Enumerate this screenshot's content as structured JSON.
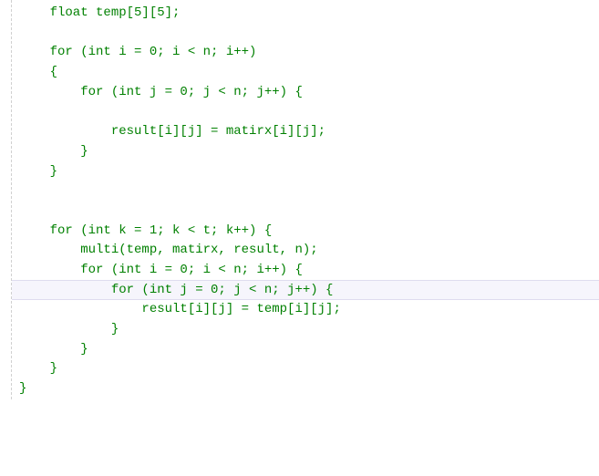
{
  "code": {
    "lines": [
      "    float temp[5][5];",
      "",
      "    for (int i = 0; i < n; i++)",
      "    {",
      "        for (int j = 0; j < n; j++) {",
      "",
      "            result[i][j] = matirx[i][j];",
      "        }",
      "    }",
      "",
      "",
      "    for (int k = 1; k < t; k++) {",
      "        multi(temp, matirx, result, n);",
      "        for (int i = 0; i < n; i++) {",
      "            for (int j = 0; j < n; j++) {",
      "                result[i][j] = temp[i][j];",
      "            }",
      "        }",
      "    }",
      "}"
    ],
    "highlighted_line_index": 14
  },
  "colors": {
    "text": "#008000",
    "guide": "#d0d0d0",
    "highlight_bg": "rgba(230,225,245,0.35)"
  }
}
